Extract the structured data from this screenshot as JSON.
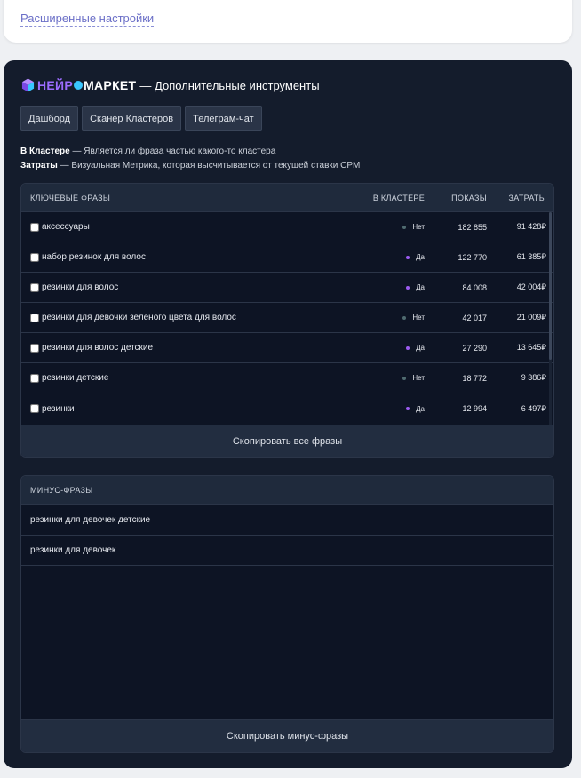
{
  "advanced_settings_link": "Расширенные настройки",
  "brand": {
    "name_part1": "НЕЙР",
    "name_part2": "МАРКЕТ",
    "tagline": "— Дополнительные инструменты"
  },
  "tool_tabs": [
    "Дашборд",
    "Сканер Кластеров",
    "Телеграм-чат"
  ],
  "notes": [
    {
      "term": "В Кластере",
      "text": " — Является ли фраза частью какого-то кластера"
    },
    {
      "term": "Затраты",
      "text": " — Визуальная Метрика, которая высчитывается от текущей ставки CPM"
    }
  ],
  "keywords_table": {
    "columns": [
      "КЛЮЧЕВЫЕ ФРАЗЫ",
      "В КЛАСТЕРЕ",
      "ПОКАЗЫ",
      "ЗАТРАТЫ"
    ],
    "rows": [
      {
        "phrase": "аксессуары",
        "in_cluster": "Нет",
        "shows": "182 855",
        "cost": "91 428₽"
      },
      {
        "phrase": "набор резинок для волос",
        "in_cluster": "Да",
        "shows": "122 770",
        "cost": "61 385₽"
      },
      {
        "phrase": "резинки для волос",
        "in_cluster": "Да",
        "shows": "84 008",
        "cost": "42 004₽"
      },
      {
        "phrase": "резинки для девочки зеленого цвета для волос",
        "in_cluster": "Нет",
        "shows": "42 017",
        "cost": "21 009₽"
      },
      {
        "phrase": "резинки для волос детские",
        "in_cluster": "Да",
        "shows": "27 290",
        "cost": "13 645₽"
      },
      {
        "phrase": "резинки детские",
        "in_cluster": "Нет",
        "shows": "18 772",
        "cost": "9 386₽"
      },
      {
        "phrase": "резинки",
        "in_cluster": "Да",
        "shows": "12 994",
        "cost": "6 497₽"
      }
    ],
    "copy_button": "Скопировать все фразы"
  },
  "minus_phrases": {
    "header": "МИНУС-ФРАЗЫ",
    "items": [
      "резинки для девочек детские",
      "резинки для девочек"
    ],
    "copy_button": "Скопировать минус-фразы"
  },
  "colors": {
    "panel_bg": "#141c2c",
    "yes_dot": "#9c5cf0",
    "no_dot": "#4f6b70",
    "brand_purple": "#9c6cff",
    "brand_blue": "#39c6ff",
    "link": "#6b6fc7"
  }
}
